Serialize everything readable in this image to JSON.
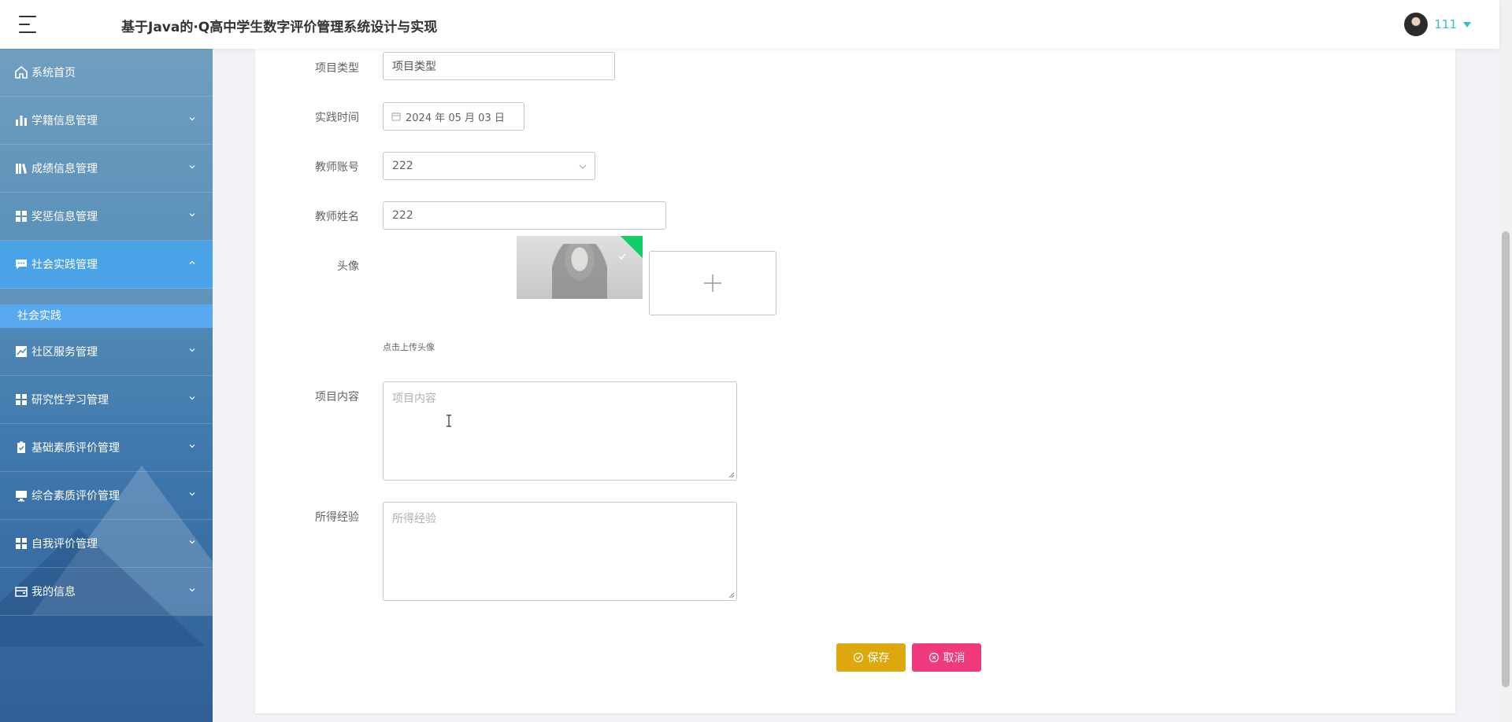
{
  "header": {
    "title": "基于Java的·Q高中学生数字评价管理系统设计与实现",
    "user_name": "111"
  },
  "sidebar": {
    "items": [
      {
        "label": "系统首页",
        "icon": "home-icon"
      },
      {
        "label": "学籍信息管理",
        "icon": "bar-chart-icon"
      },
      {
        "label": "成绩信息管理",
        "icon": "books-icon"
      },
      {
        "label": "奖惩信息管理",
        "icon": "grid-icon"
      },
      {
        "label": "社会实践管理",
        "icon": "chat-icon"
      },
      {
        "label": "社区服务管理",
        "icon": "trend-icon"
      },
      {
        "label": "研究性学习管理",
        "icon": "grid-icon"
      },
      {
        "label": "基础素质评价管理",
        "icon": "clipboard-icon"
      },
      {
        "label": "综合素质评价管理",
        "icon": "monitor-icon"
      },
      {
        "label": "自我评价管理",
        "icon": "grid-icon"
      },
      {
        "label": "我的信息",
        "icon": "wallet-icon"
      }
    ],
    "sub_item": "社会实践"
  },
  "form": {
    "project_type": {
      "label": "项目类型",
      "value": "项目类型"
    },
    "practice_time": {
      "label": "实践时间",
      "value": "2024 年 05 月 03 日"
    },
    "teacher_account": {
      "label": "教师账号",
      "value": "222"
    },
    "teacher_name": {
      "label": "教师姓名",
      "value": "222"
    },
    "avatar": {
      "label": "头像",
      "hint": "点击上传头像"
    },
    "project_content": {
      "label": "项目内容",
      "placeholder": "项目内容"
    },
    "experience": {
      "label": "所得经验",
      "placeholder": "所得经验"
    },
    "save_label": "保存",
    "cancel_label": "取消"
  },
  "colors": {
    "accent": "#30bfcf",
    "menu_active": "#4aa3e6",
    "save": "#dca80d",
    "cancel": "#f0397e"
  }
}
